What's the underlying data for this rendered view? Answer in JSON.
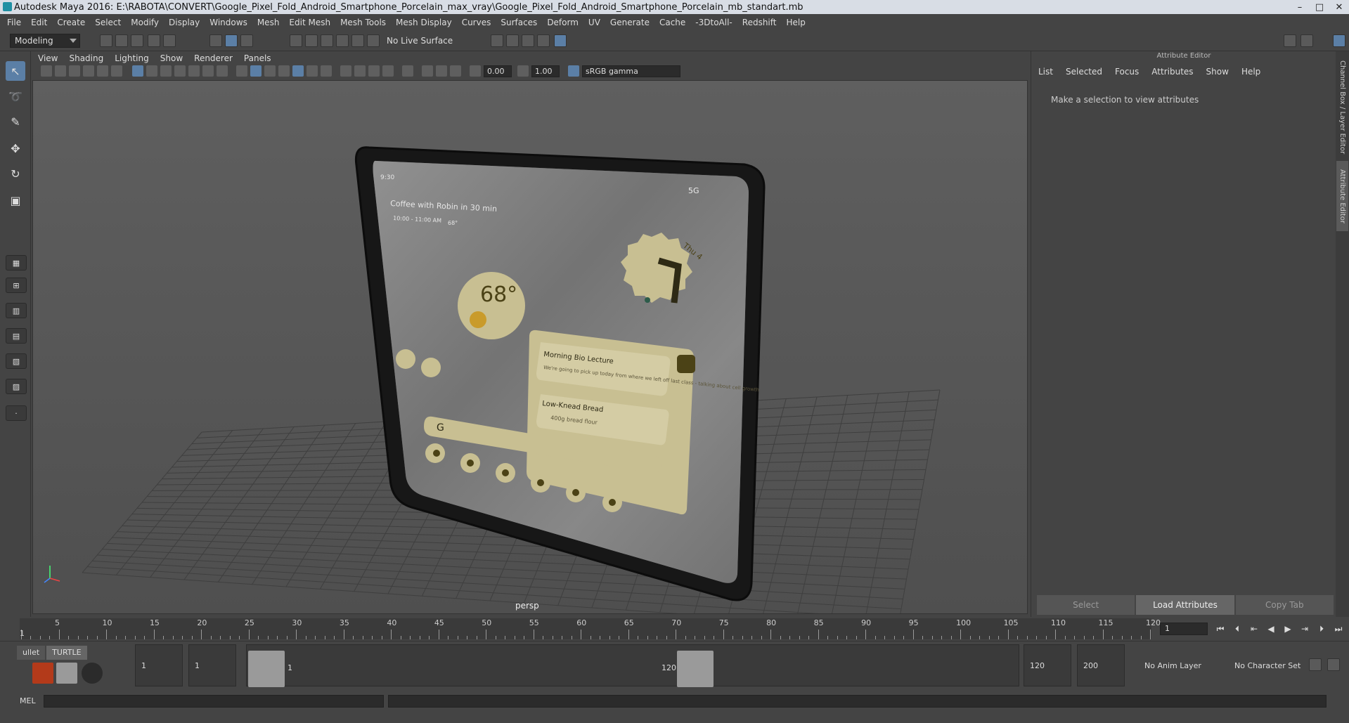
{
  "titlebar": {
    "title": "Autodesk Maya 2016: E:\\RABOTA\\CONVERT\\Google_Pixel_Fold_Android_Smartphone_Porcelain_max_vray\\Google_Pixel_Fold_Android_Smartphone_Porcelain_mb_standart.mb",
    "minimize": "–",
    "maximize": "□",
    "close": "✕"
  },
  "menubar": {
    "items": [
      "File",
      "Edit",
      "Create",
      "Select",
      "Modify",
      "Display",
      "Windows",
      "Mesh",
      "Edit Mesh",
      "Mesh Tools",
      "Mesh Display",
      "Curves",
      "Surfaces",
      "Deform",
      "UV",
      "Generate",
      "Cache",
      "-3DtoAll-",
      "Redshift",
      "Help"
    ]
  },
  "statusline": {
    "mode": "Modeling",
    "live_surface": "No Live Surface"
  },
  "viewport": {
    "menu": [
      "View",
      "Shading",
      "Lighting",
      "Show",
      "Renderer",
      "Panels"
    ],
    "exposure": "0.00",
    "gamma": "1.00",
    "color_space": "sRGB gamma",
    "camera_label": "persp",
    "phone": {
      "time": "9:30",
      "network": "5G",
      "event_title": "Coffee with Robin in 30 min",
      "event_detail": "10:00 - 11:00 AM",
      "event_temp": "68°",
      "weather_temp": "68°",
      "clock_day": "Thu 4",
      "note1_title": "Morning Bio Lecture",
      "note1_body": "We're going to pick up today from where we left off last class - talking about cell growth",
      "note2_title": "Low-Knead Bread",
      "note2_item": "400g bread flour",
      "search_glyph": "G"
    }
  },
  "attribute_editor": {
    "title": "Attribute Editor",
    "menu": [
      "List",
      "Selected",
      "Focus",
      "Attributes",
      "Show",
      "Help"
    ],
    "message": "Make a selection to view attributes",
    "buttons": [
      "Select",
      "Load Attributes",
      "Copy Tab"
    ]
  },
  "side_tabs": [
    "Channel Box / Layer Editor",
    "Attribute Editor"
  ],
  "timeslider": {
    "ticks": [
      1,
      5,
      10,
      15,
      20,
      25,
      30,
      35,
      40,
      45,
      50,
      55,
      60,
      65,
      70,
      75,
      80,
      85,
      90,
      95,
      100,
      105,
      110,
      115,
      120
    ],
    "start_label": "1",
    "current_frame": "1"
  },
  "range": {
    "shelf_tabs": [
      "ullet",
      "TURTLE"
    ],
    "start_field": "1",
    "playback_start": "1",
    "range_start_label": "1",
    "range_end_label": "120",
    "playback_end": "120",
    "end_field": "200",
    "anim_layer": "No Anim Layer",
    "character_set": "No Character Set"
  },
  "cmdline": {
    "label": "MEL"
  }
}
